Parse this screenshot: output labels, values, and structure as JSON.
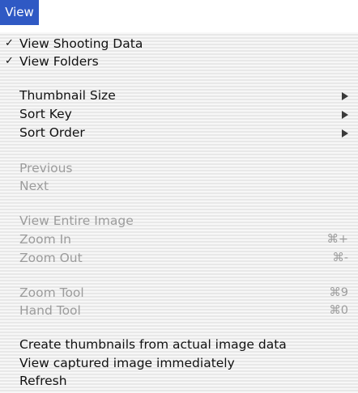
{
  "menubar": {
    "title": "View"
  },
  "menu": {
    "view_shooting_data": {
      "check": "✓",
      "label": "View Shooting Data"
    },
    "view_folders": {
      "check": "✓",
      "label": "View Folders"
    },
    "thumbnail_size": {
      "label": "Thumbnail Size"
    },
    "sort_key": {
      "label": "Sort Key"
    },
    "sort_order": {
      "label": "Sort Order"
    },
    "previous": {
      "label": "Previous"
    },
    "next": {
      "label": "Next"
    },
    "view_entire_image": {
      "label": "View Entire Image"
    },
    "zoom_in": {
      "label": "Zoom In",
      "shortcut": "⌘+"
    },
    "zoom_out": {
      "label": "Zoom Out",
      "shortcut": "⌘-"
    },
    "zoom_tool": {
      "label": "Zoom Tool",
      "shortcut": "⌘9"
    },
    "hand_tool": {
      "label": "Hand Tool",
      "shortcut": "⌘0"
    },
    "create_thumbnails": {
      "label": "Create thumbnails from actual image data"
    },
    "view_captured": {
      "label": "View captured image immediately"
    },
    "refresh": {
      "label": "Refresh"
    }
  },
  "colors": {
    "menubar_highlight": "#2f59c4",
    "enabled_text": "#111111",
    "disabled_text": "#9c9c9c"
  }
}
